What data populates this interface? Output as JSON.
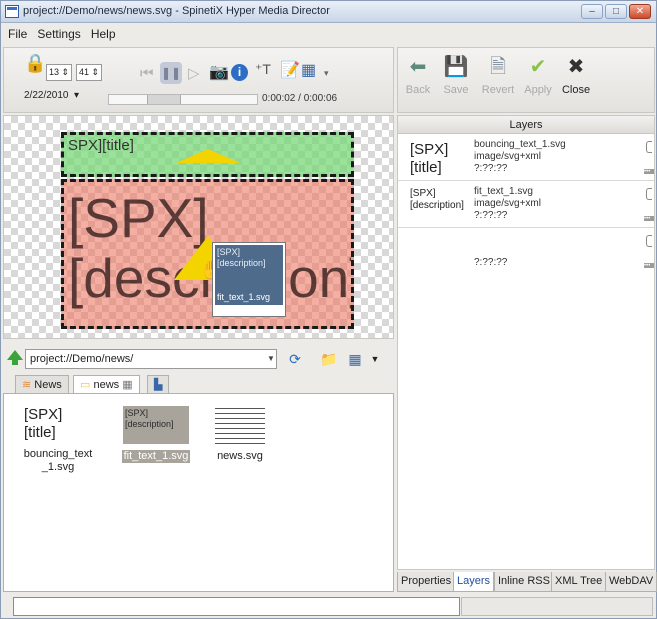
{
  "window": {
    "title": "project://Demo/news/news.svg - SpinetiX Hyper Media Director",
    "minimize": "–",
    "maximize": "□",
    "close": "✕"
  },
  "menu": [
    "File",
    "Settings",
    "Help"
  ],
  "player": {
    "spin1": "13",
    "spin2": "41",
    "date": "2/22/2010",
    "timecode": "0:00:02 / 0:00:06",
    "progress_fraction": 0.33
  },
  "canvas": {
    "title_layer_text": "SPX][title]",
    "desc_layer_text": "[SPX]\n[description]",
    "popup_top": "[SPX]\n[description]",
    "popup_bottom": "fit_text_1.svg"
  },
  "path": {
    "value": "project://Demo/news/"
  },
  "file_tabs": [
    {
      "label": "News",
      "active": false
    },
    {
      "label": "news",
      "active": true
    },
    {
      "label": "",
      "active": false
    }
  ],
  "files": [
    {
      "thumb": "[SPX]\n[title]",
      "name": "bouncing_text\n_1.svg",
      "selected": false
    },
    {
      "thumb": "[SPX]\n[description]",
      "name": "fit_text_1.svg",
      "selected": true
    },
    {
      "thumb": "",
      "name": "news.svg",
      "selected": false
    }
  ],
  "right_toolbar": {
    "back": "Back",
    "save": "Save",
    "revert": "Revert",
    "apply": "Apply",
    "close": "Close"
  },
  "layers": {
    "header": "Layers",
    "rows": [
      {
        "name": "[SPX]\n[title]",
        "file": "bouncing_text_1.svg",
        "type": "image/svg+xml",
        "time": "?:??:??"
      },
      {
        "name": "[SPX]\n[description]",
        "file": "fit_text_1.svg",
        "type": "image/svg+xml",
        "time": "?:??:??"
      },
      {
        "name": "",
        "file": "",
        "type": "",
        "time": "?:??:??"
      }
    ]
  },
  "bottom_tabs": [
    {
      "label": "Properties",
      "active": false
    },
    {
      "label": "Layers",
      "active": true
    },
    {
      "label": "Inline RSS",
      "active": false
    },
    {
      "label": "XML Tree",
      "active": false
    },
    {
      "label": "WebDAV",
      "active": false
    }
  ],
  "colors": {
    "title_layer": "#78d778",
    "desc_layer": "#ec7864",
    "accent": "#3b72c0",
    "warning": "#f3d300"
  }
}
